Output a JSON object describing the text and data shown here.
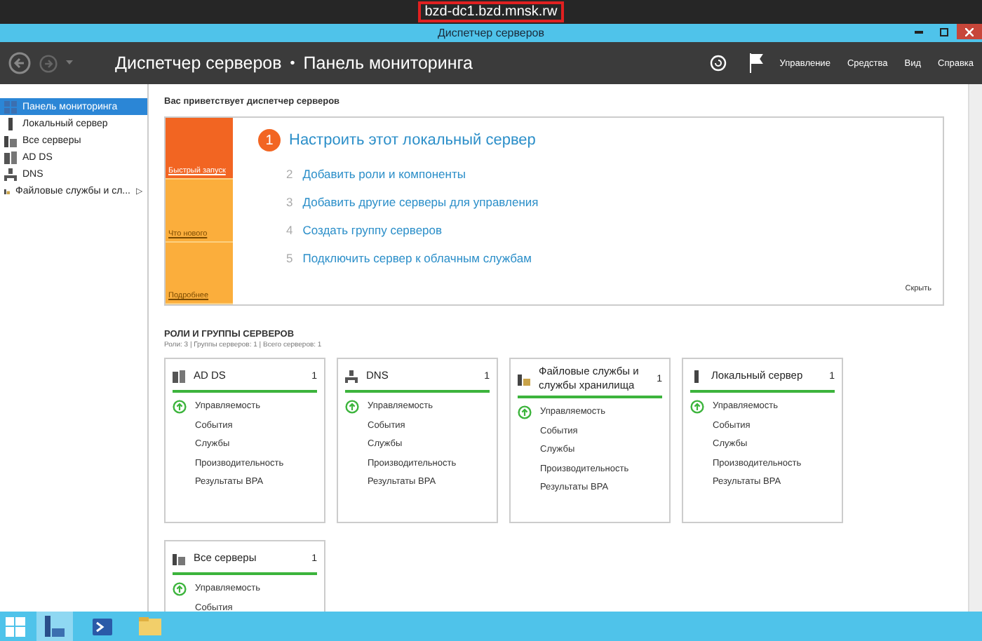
{
  "host_label": "bzd-dc1.bzd.mnsk.rw",
  "window": {
    "title": "Диспетчер серверов"
  },
  "nav": {
    "title": "Диспетчер серверов",
    "separator": "•",
    "page": "Панель мониторинга",
    "menus": [
      "Управление",
      "Средства",
      "Вид",
      "Справка"
    ]
  },
  "sidebar": {
    "items": [
      {
        "label": "Панель мониторинга",
        "selected": true
      },
      {
        "label": "Локальный сервер",
        "selected": false
      },
      {
        "label": "Все серверы",
        "selected": false
      },
      {
        "label": "AD DS",
        "selected": false
      },
      {
        "label": "DNS",
        "selected": false
      },
      {
        "label": "Файловые службы и сл...",
        "selected": false,
        "expander": "▷"
      }
    ]
  },
  "welcome": {
    "heading": "Вас приветствует диспетчер серверов",
    "tiles": [
      {
        "label": "Быстрый запуск",
        "selected": true
      },
      {
        "label": "Что нового",
        "selected": false
      },
      {
        "label": "Подробнее",
        "selected": false
      }
    ],
    "steps": [
      {
        "number": "1",
        "label": "Настроить этот локальный сервер",
        "kind": "primary"
      },
      {
        "number": "2",
        "label": "Добавить роли и компоненты",
        "kind": "secondary"
      },
      {
        "number": "3",
        "label": "Добавить другие серверы для управления",
        "kind": "secondary"
      },
      {
        "number": "4",
        "label": "Создать группу серверов",
        "kind": "secondary"
      },
      {
        "number": "5",
        "label": "Подключить сервер к облачным службам",
        "kind": "secondary"
      }
    ],
    "hide_link": "Скрыть"
  },
  "roles": {
    "heading": "РОЛИ И ГРУППЫ СЕРВЕРОВ",
    "summary": "Роли: 3 | Группы серверов: 1 | Всего серверов: 1",
    "cards": [
      {
        "title": "AD DS",
        "count": "1",
        "items": [
          {
            "label": "Управляемость",
            "kind": "status"
          },
          {
            "label": "События",
            "kind": "plain"
          },
          {
            "label": "Службы",
            "kind": "plain"
          },
          {
            "label": "Производительность",
            "kind": "plain"
          },
          {
            "label": "Результаты BPA",
            "kind": "plain"
          }
        ]
      },
      {
        "title": "DNS",
        "count": "1",
        "items": [
          {
            "label": "Управляемость",
            "kind": "status"
          },
          {
            "label": "События",
            "kind": "plain"
          },
          {
            "label": "Службы",
            "kind": "plain"
          },
          {
            "label": "Производительность",
            "kind": "plain"
          },
          {
            "label": "Результаты BPA",
            "kind": "plain"
          }
        ]
      },
      {
        "title": "Файловые службы и службы хранилища",
        "count": "1",
        "items": [
          {
            "label": "Управляемость",
            "kind": "status"
          },
          {
            "label": "События",
            "kind": "plain"
          },
          {
            "label": "Службы",
            "kind": "plain"
          },
          {
            "label": "Производительность",
            "kind": "plain"
          },
          {
            "label": "Результаты BPA",
            "kind": "plain"
          }
        ]
      },
      {
        "title": "Локальный сервер",
        "count": "1",
        "items": [
          {
            "label": "Управляемость",
            "kind": "status"
          },
          {
            "label": "События",
            "kind": "plain"
          },
          {
            "label": "Службы",
            "kind": "plain"
          },
          {
            "label": "Производительность",
            "kind": "plain"
          },
          {
            "label": "Результаты BPA",
            "kind": "plain"
          }
        ]
      },
      {
        "title": "Все серверы",
        "count": "1",
        "items": [
          {
            "label": "Управляемость",
            "kind": "status"
          },
          {
            "label": "События",
            "kind": "plain"
          }
        ]
      }
    ]
  },
  "taskbar": {
    "apps": [
      {
        "selected": true
      },
      {
        "selected": false
      },
      {
        "selected": false
      }
    ]
  }
}
